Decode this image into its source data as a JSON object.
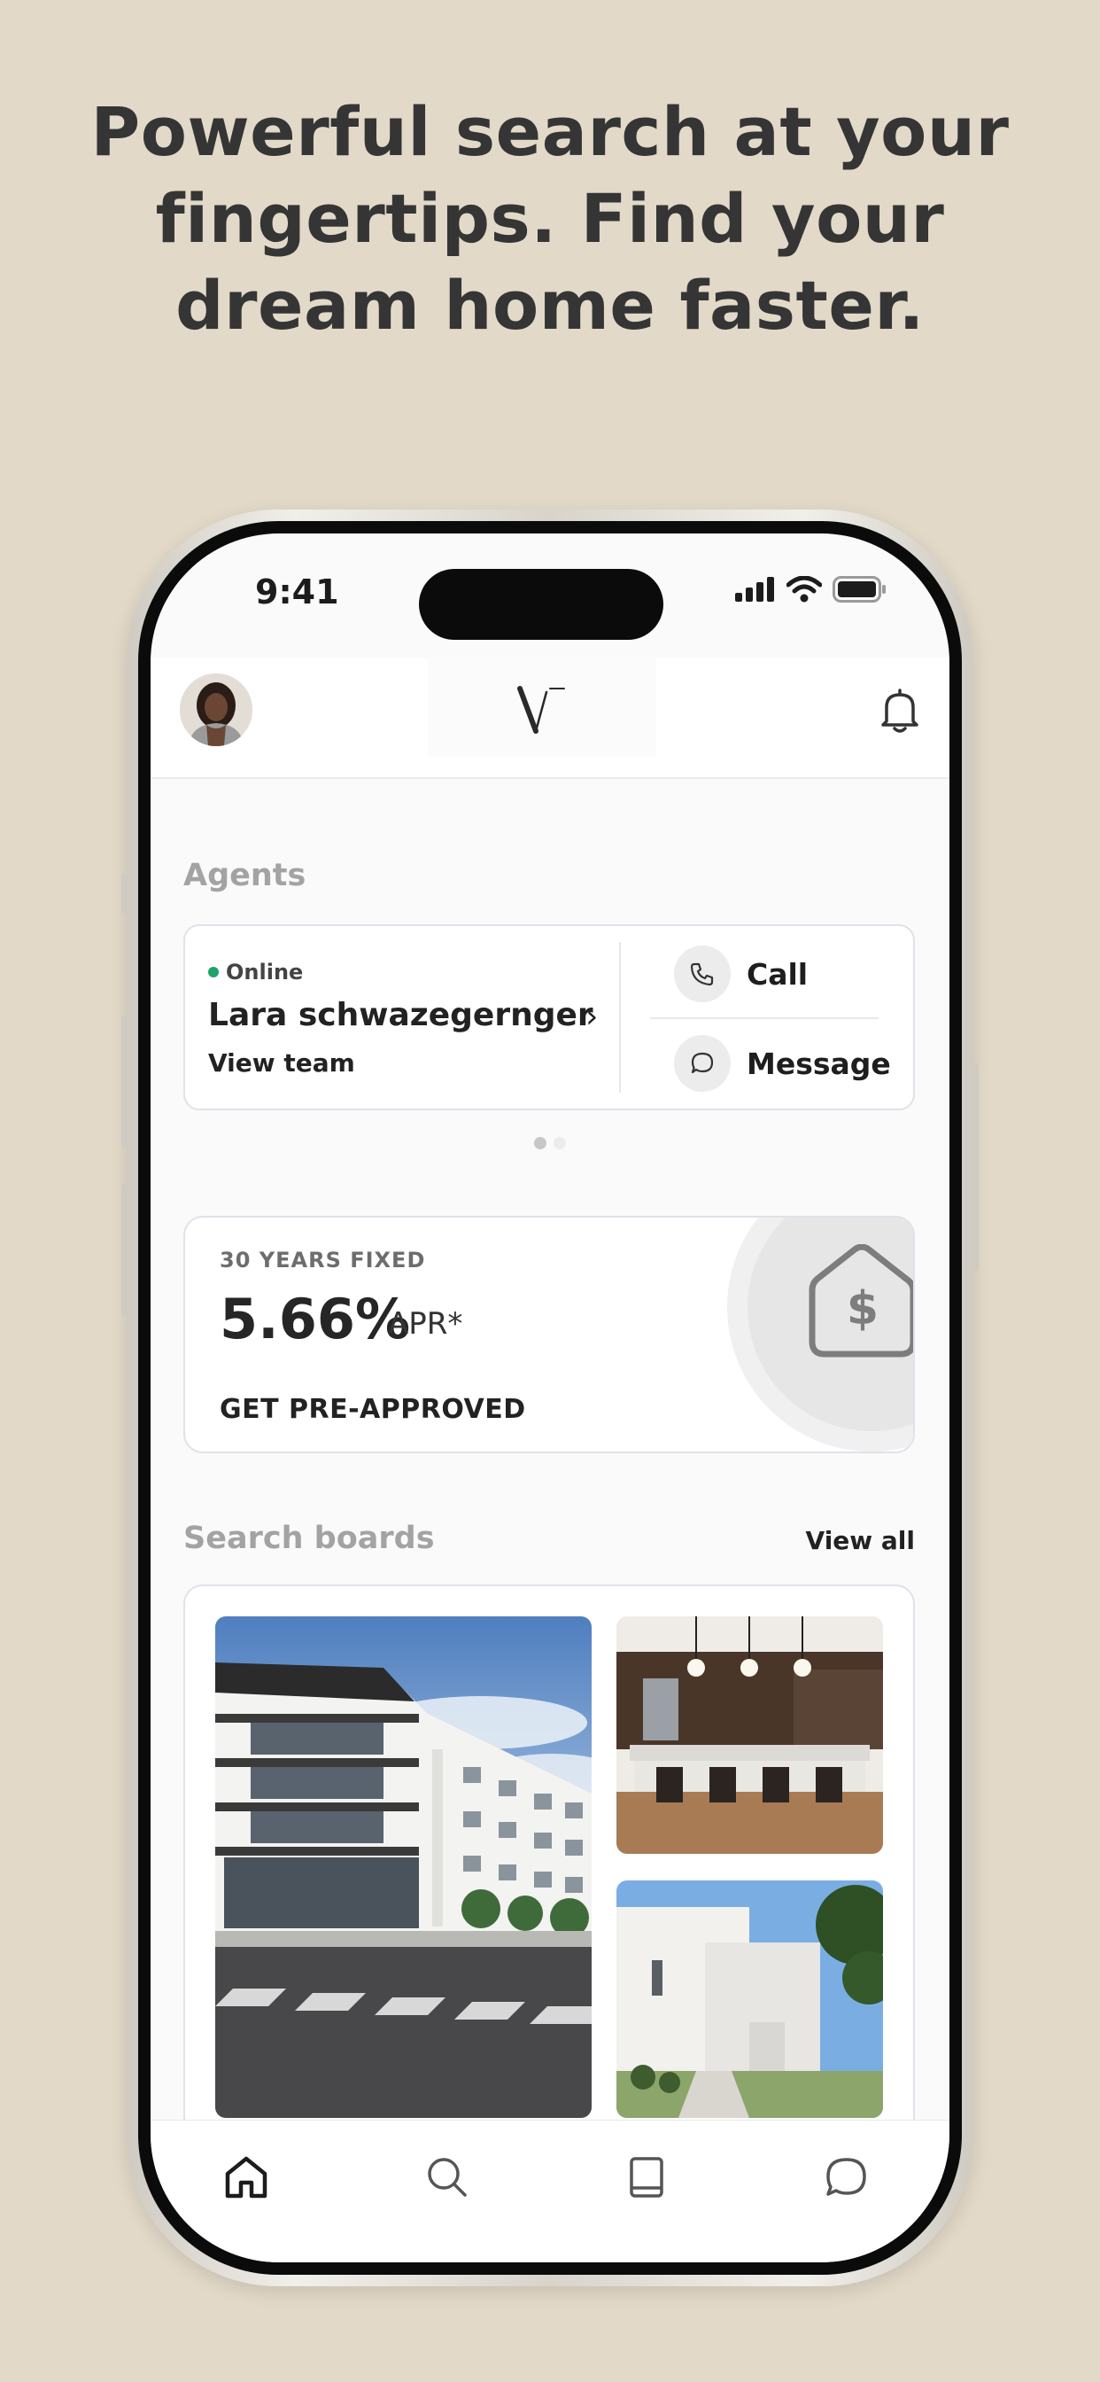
{
  "headline": {
    "line1": "Powerful search at your",
    "line2": "fingertips. Find your",
    "line3": "dream home faster."
  },
  "status_bar": {
    "time": "9:41",
    "icons": [
      "signal-icon",
      "wifi-icon",
      "battery-icon"
    ]
  },
  "header": {
    "logo_text": "V",
    "icons": [
      "avatar",
      "bell-icon"
    ]
  },
  "agents": {
    "section_title": "Agents",
    "status": "Online",
    "name": "Lara schwazegernger",
    "view_team": "View team",
    "call_label": "Call",
    "message_label": "Message",
    "pager": {
      "count": 2,
      "active_index": 0
    }
  },
  "mortgage": {
    "term": "30 YEARS FIXED",
    "rate": "5.66%",
    "rate_suffix": "APR*",
    "cta": "GET PRE-APPROVED"
  },
  "search_boards": {
    "section_title": "Search boards",
    "view_all": "View all",
    "photos": [
      "apartment-building-photo",
      "kitchen-photo",
      "white-house-photo"
    ]
  },
  "tab_bar": {
    "tabs": [
      "home-icon",
      "search-icon",
      "book-icon",
      "chat-icon"
    ],
    "active_index": 0
  },
  "colors": {
    "background": "#e2d9c8",
    "online": "#1fa36b",
    "headline": "#353535",
    "section_label": "#a3a3a3"
  }
}
